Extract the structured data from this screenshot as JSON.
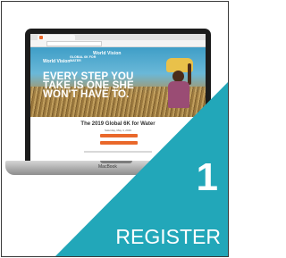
{
  "site": {
    "logo": "World Vision",
    "brand_left": "World Vision",
    "brand_right": "GLOBAL 6K FOR WATER",
    "headline": "EVERY STEP YOU TAKE IS ONE SHE WON'T HAVE TO.",
    "event_title": "The 2019 Global 6K for Water",
    "event_date": "Saturday, May 4, 2019"
  },
  "laptop": {
    "label": "MacBook"
  },
  "step": {
    "number": "1",
    "label": "REGISTER"
  },
  "colors": {
    "teal": "#22a7b9",
    "orange": "#e9682b"
  }
}
